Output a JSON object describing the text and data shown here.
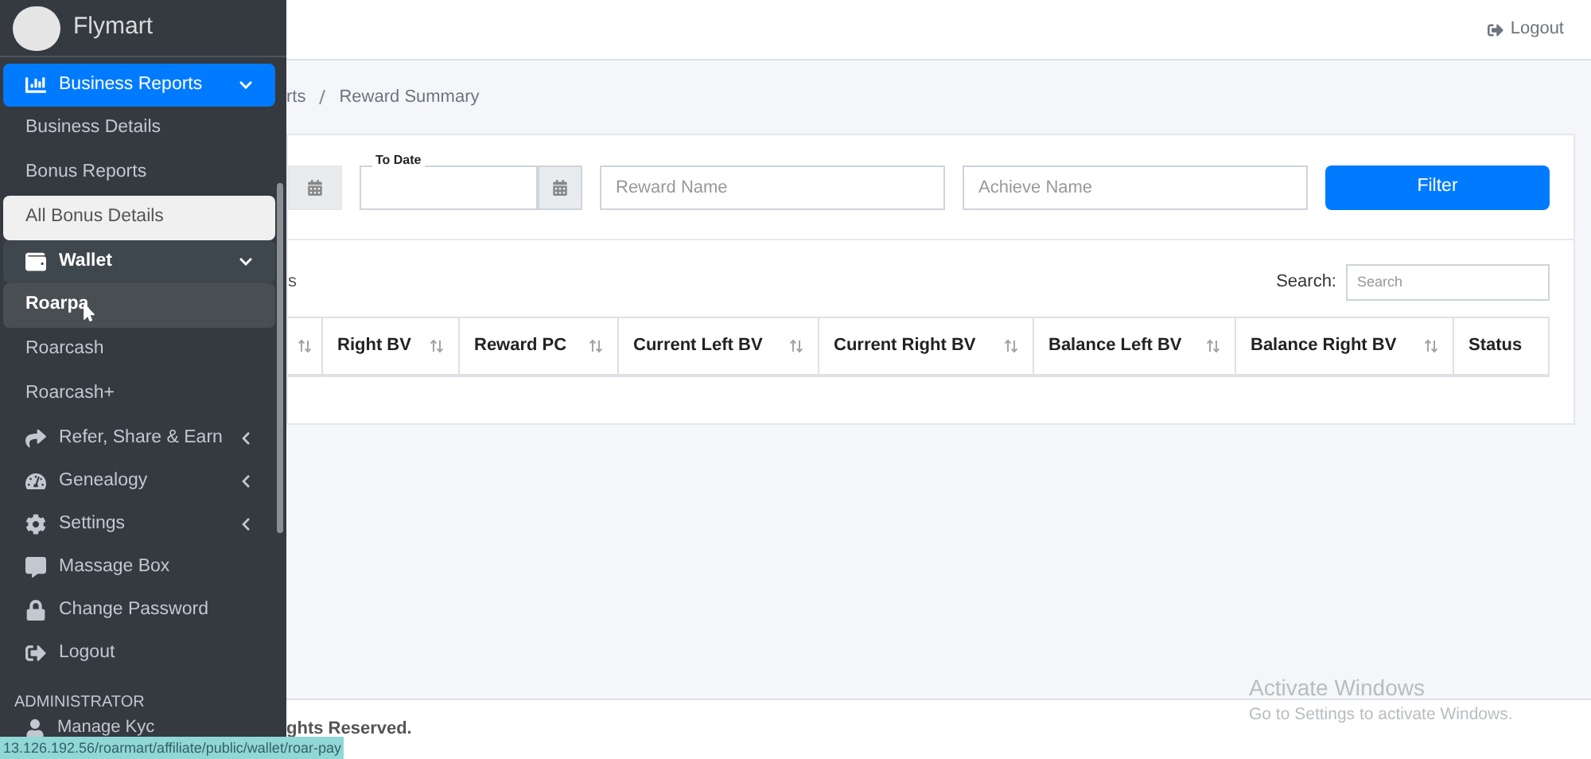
{
  "brand": {
    "name": "Flymart"
  },
  "sidebar": {
    "items": [
      {
        "label": "Business Reports",
        "expanded": true,
        "selected": true,
        "children": [
          {
            "label": "Business Details",
            "selected": false
          },
          {
            "label": "Bonus Reports",
            "selected": false
          },
          {
            "label": "All Bonus Details",
            "selected": true
          }
        ]
      },
      {
        "label": "Wallet",
        "expanded": true,
        "selected": false,
        "children": [
          {
            "label": "Roarpa",
            "selected": false,
            "hovered": true
          },
          {
            "label": "Roarcash",
            "selected": false,
            "hovered": false
          },
          {
            "label": "Roarcash+",
            "selected": false,
            "hovered": false
          }
        ]
      },
      {
        "label": "Refer, Share & Earn",
        "expanded": false,
        "selected": false
      },
      {
        "label": "Genealogy",
        "expanded": false,
        "selected": false
      },
      {
        "label": "Settings",
        "expanded": false,
        "selected": false
      },
      {
        "label": "Massage Box",
        "selected": false
      },
      {
        "label": "Change Password",
        "selected": false
      },
      {
        "label": "Logout",
        "selected": false
      }
    ],
    "section_header": "ADMINISTRATOR",
    "section_items": [
      {
        "label": "Manage Kyc",
        "selected": false
      }
    ]
  },
  "topbar": {
    "logout": "Logout"
  },
  "breadcrumb": [
    "rts",
    "Reward Summary"
  ],
  "filters": {
    "to_date_label": "To Date",
    "reward_placeholder": "Reward Name",
    "achieve_placeholder": "Achieve Name",
    "button": "Filter"
  },
  "table": {
    "length_label": "s",
    "search_label": "Search:",
    "search_placeholder": "Search",
    "columns": [
      {
        "label": "Right BV",
        "sortable": true
      },
      {
        "label": "Reward PC",
        "sortable": true
      },
      {
        "label": "Current Left BV",
        "sortable": true
      },
      {
        "label": "Current Right BV",
        "sortable": true
      },
      {
        "label": "Balance Left BV",
        "sortable": true
      },
      {
        "label": "Balance Right BV",
        "sortable": true
      },
      {
        "label": "Status",
        "sortable": false
      }
    ]
  },
  "footer": "ghts Reserved.",
  "activation": {
    "title": "Activate Windows",
    "text": "Go to Settings to activate Windows."
  },
  "status_url": "13.126.192.56/roarmart/affiliate/public/wallet/roar-pay"
}
